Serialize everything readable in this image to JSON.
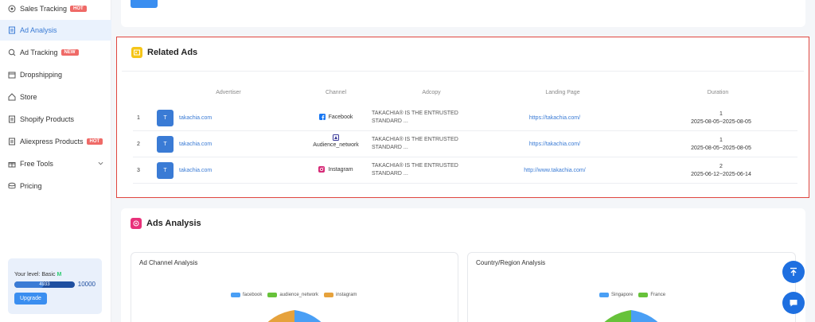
{
  "sidebar": {
    "items": [
      {
        "label": "Sales Tracking",
        "badge": "HOT",
        "icon": "target-icon"
      },
      {
        "label": "Ad Analysis",
        "badge": "",
        "icon": "document-icon",
        "active": true
      },
      {
        "label": "Ad Tracking",
        "badge": "NEW",
        "icon": "search-icon"
      },
      {
        "label": "Dropshipping",
        "badge": "",
        "icon": "box-icon"
      },
      {
        "label": "Store",
        "badge": "",
        "icon": "store-icon"
      },
      {
        "label": "Shopify Products",
        "badge": "",
        "icon": "list-icon"
      },
      {
        "label": "Aliexpress Products",
        "badge": "HOT",
        "icon": "list-icon"
      },
      {
        "label": "Free Tools",
        "badge": "",
        "icon": "gift-icon"
      },
      {
        "label": "Pricing",
        "badge": "",
        "icon": "stack-icon"
      }
    ],
    "level": {
      "label": "Your level: Basic",
      "tier": "M",
      "current": "4933",
      "max": "10000",
      "progress": 0.4933,
      "upgrade_label": "Upgrade"
    }
  },
  "related_ads": {
    "title": "Related Ads",
    "columns": [
      "Advertiser",
      "Channel",
      "Adcopy",
      "Landing Page",
      "Duration"
    ],
    "rows": [
      {
        "rank": "1",
        "avatar": "T",
        "advertiser": "takachia.com",
        "channel": "Facebook",
        "adcopy_1": "TAKACHIA® IS THE ENTRUSTED",
        "adcopy_2": "STANDARD ...",
        "landing": "https://takachia.com/",
        "days": "1",
        "range": "2025-08-05~2025-08-05"
      },
      {
        "rank": "2",
        "avatar": "T",
        "advertiser": "takachia.com",
        "channel": "Audience_network",
        "adcopy_1": "TAKACHIA® IS THE ENTRUSTED",
        "adcopy_2": "STANDARD ...",
        "landing": "https://takachia.com/",
        "days": "1",
        "range": "2025-08-05~2025-08-05"
      },
      {
        "rank": "3",
        "avatar": "T",
        "advertiser": "takachia.com",
        "channel": "Instagram",
        "adcopy_1": "TAKACHIA® IS THE ENTRUSTED",
        "adcopy_2": "STANDARD ...",
        "landing": "http://www.takachia.com/",
        "days": "2",
        "range": "2025-06-12~2025-06-14"
      }
    ]
  },
  "ads_analysis": {
    "title": "Ads Analysis",
    "channel_card": {
      "title": "Ad Channel Analysis",
      "legend": [
        "facebook",
        "audience_network",
        "instagram"
      ],
      "colors": [
        "#4a9ff5",
        "#67c23a",
        "#e6a23c"
      ]
    },
    "country_card": {
      "title": "Country/Region Analysis",
      "legend": [
        "Singapore",
        "France"
      ],
      "colors": [
        "#4a9ff5",
        "#67c23a"
      ]
    }
  },
  "colors": {
    "accent": "#3a7bd5",
    "highlight_border": "#e0463e"
  }
}
